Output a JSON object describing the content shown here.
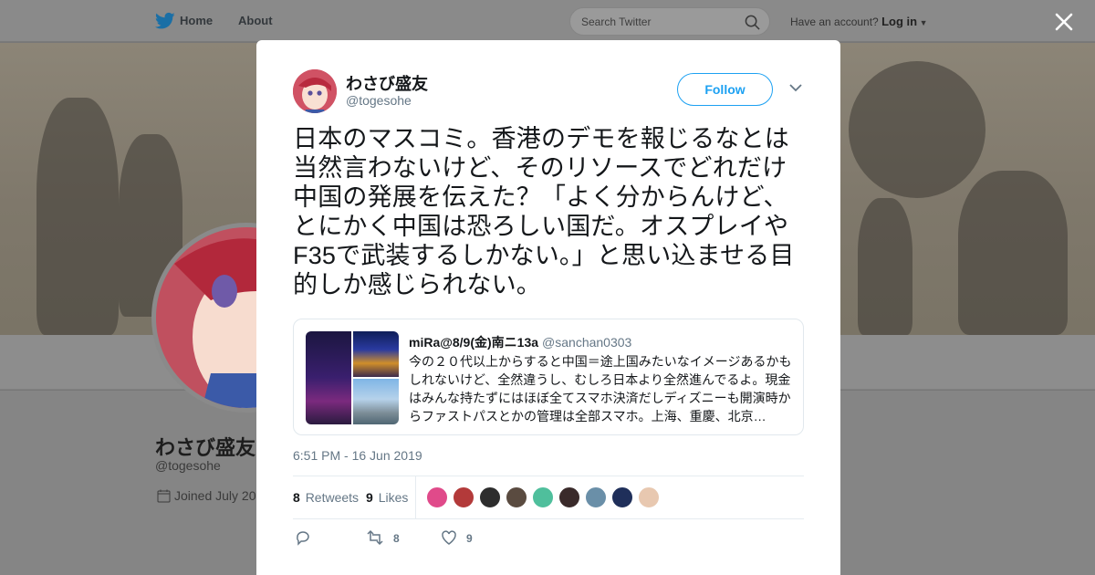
{
  "topbar": {
    "home_label": "Home",
    "about_label": "About",
    "search_placeholder": "Search Twitter",
    "account_prompt": "Have an account?",
    "login_label": "Log in"
  },
  "profile": {
    "name": "わさび盛友",
    "handle": "@togesohe",
    "joined": "Joined July 20"
  },
  "tweet": {
    "author_name": "わさび盛友",
    "author_handle": "@togesohe",
    "follow_label": "Follow",
    "text": "日本のマスコミ。香港のデモを報じるなとは当然言わないけど、そのリソースでどれだけ中国の発展を伝えた？「よく分からんけど、とにかく中国は恐ろしい国だ。オスプレイやF35で武装するしかない。」と思い込ませる目的しか感じられない。",
    "quoted": {
      "name": "miRa@8/9(金)南ニ13a",
      "handle": "@sanchan0303",
      "text": "今の２０代以上からすると中国＝途上国みたいなイメージあるかもしれないけど、全然違うし、むしろ日本より全然進んでるよ。現金はみんな持たずにはほぼ全てスマホ決済だしディズニーも開演時からファストパスとかの管理は全部スマホ。上海、重慶、北京…"
    },
    "timestamp": "6:51 PM - 16 Jun 2019",
    "retweets_count": "8",
    "retweets_label": "Retweets",
    "likes_count": "9",
    "likes_label": "Likes",
    "action_retweet_count": "8",
    "action_like_count": "9"
  },
  "colors": {
    "accent": "#1da1f2",
    "text_primary": "#14171a",
    "text_secondary": "#657786"
  }
}
